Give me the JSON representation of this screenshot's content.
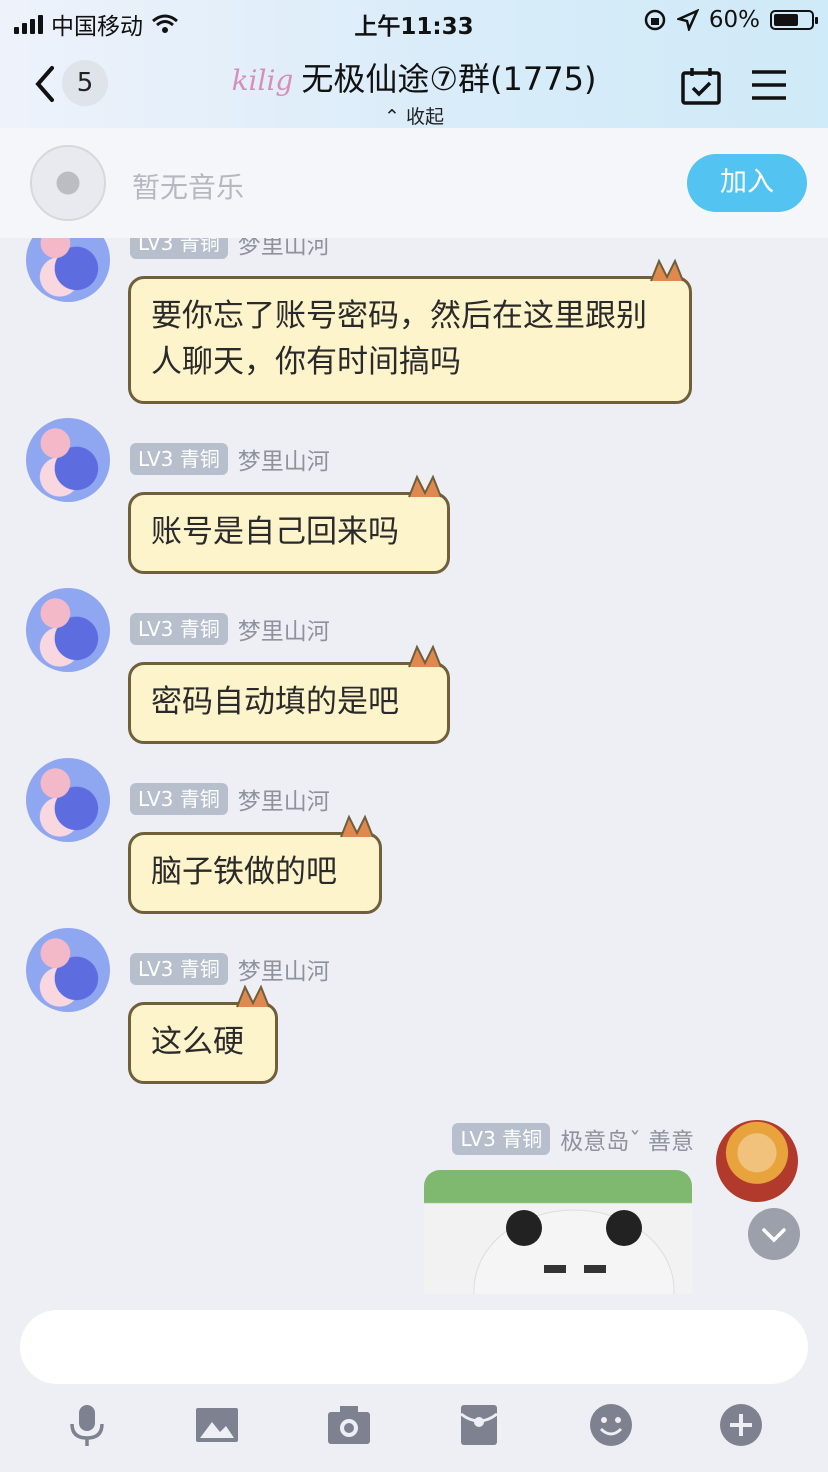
{
  "status_bar": {
    "carrier": "中国移动",
    "time": "上午11:33",
    "battery": "60%"
  },
  "header": {
    "back_count": "5",
    "logo_text": "kilig",
    "title": "无极仙途⑦群(1775)",
    "collapse_label": "收起"
  },
  "music_bar": {
    "text": "暂无音乐",
    "join_label": "加入"
  },
  "messages": [
    {
      "level": "LV3 青铜",
      "nick": "梦里山河",
      "text": "要你忘了账号密码，然后在这里跟别人聊天，你有时间搞吗"
    },
    {
      "level": "LV3 青铜",
      "nick": "梦里山河",
      "text": "账号是自己回来吗"
    },
    {
      "level": "LV3 青铜",
      "nick": "梦里山河",
      "text": "密码自动填的是吧"
    },
    {
      "level": "LV3 青铜",
      "nick": "梦里山河",
      "text": "脑子铁做的吧"
    },
    {
      "level": "LV3 青铜",
      "nick": "梦里山河",
      "text": "这么硬"
    }
  ],
  "self_message": {
    "level": "LV3 青铜",
    "nick": "极意岛ˇ  善意"
  },
  "icons": [
    "chevron-left-icon",
    "calendar-check-icon",
    "menu-icon",
    "music-disc-icon",
    "microphone-icon",
    "image-icon",
    "camera-icon",
    "red-packet-icon",
    "emoji-icon",
    "plus-icon",
    "chevron-down-icon"
  ],
  "colors": {
    "accent": "#53c3f2",
    "bubble": "#fdf4cc",
    "bubble_border": "#6f5f3b",
    "level_badge": "#b7bfcd"
  }
}
